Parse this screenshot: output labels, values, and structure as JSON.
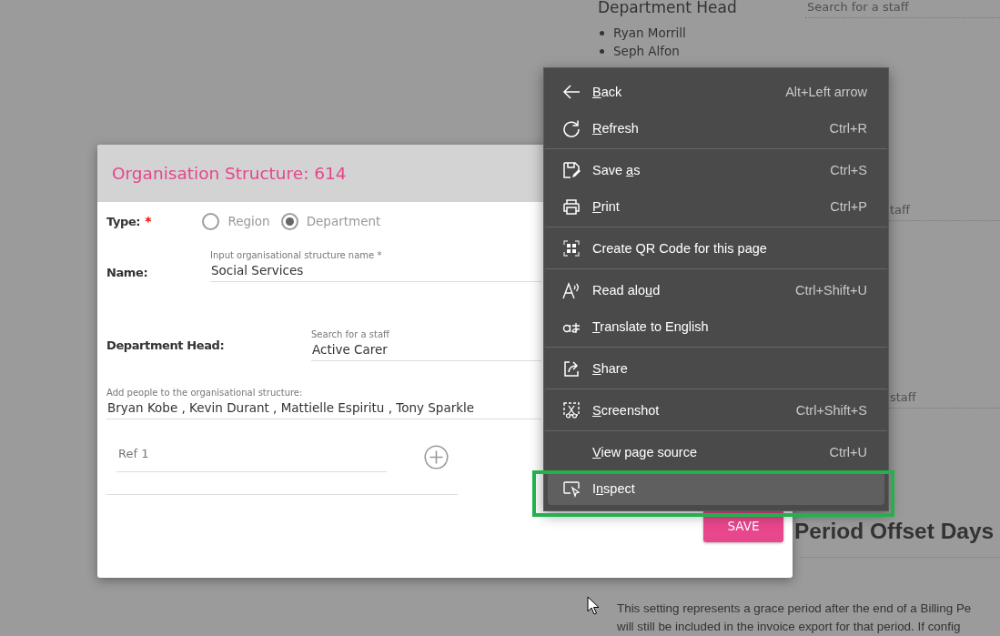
{
  "background_page": {
    "department_head": {
      "heading": "Department Head",
      "people": [
        "Ryan Morrill",
        "Seph Alfon"
      ]
    },
    "staff_search_fields": [
      {
        "placeholder": "Search for a staff"
      },
      {
        "placeholder": "taff"
      },
      {
        "placeholder": "staff"
      }
    ],
    "offset_section": {
      "heading": "Period Offset Days",
      "description_lines": [
        "This setting represents a grace period after the end of a Billing Pe",
        "will still be included in the invoice export for that period. If config"
      ]
    }
  },
  "dialog": {
    "title": "Organisation Structure: 614",
    "type_label": "Type:",
    "required_mark": "*",
    "type_options": [
      {
        "label": "Region",
        "selected": false
      },
      {
        "label": "Department",
        "selected": true
      }
    ],
    "name_label": "Name:",
    "name_field": {
      "label": "Input organisational structure name *",
      "value": "Social Services"
    },
    "head_label": "Department Head:",
    "head_field": {
      "label": "Search for a staff",
      "value": "Active Carer"
    },
    "people_field": {
      "label": "Add people to the organisational structure:",
      "value": "Bryan Kobe , Kevin Durant , Mattielle Espiritu , Tony Sparkle"
    },
    "ref_field": {
      "placeholder": "Ref 1"
    },
    "save_button": "SAVE"
  },
  "context_menu": {
    "groups": [
      {
        "items": [
          {
            "kind": "back",
            "access_key": "B",
            "label_rest": "ack",
            "shortcut": "Alt+Left arrow",
            "selected": false
          },
          {
            "kind": "refresh",
            "access_key": "R",
            "label_rest": "efresh",
            "shortcut": "Ctrl+R",
            "selected": false
          }
        ]
      },
      {
        "items": [
          {
            "kind": "save",
            "label_start": "Save ",
            "access_key": "a",
            "label_rest": "s",
            "shortcut": "Ctrl+S",
            "selected": false
          },
          {
            "kind": "print",
            "access_key": "P",
            "label_rest": "rint",
            "shortcut": "Ctrl+P",
            "selected": false
          }
        ]
      },
      {
        "items": [
          {
            "kind": "qr",
            "label_start": "Create QR Code for this page",
            "selected": false
          }
        ]
      },
      {
        "items": [
          {
            "kind": "read",
            "label_start": "Read alo",
            "access_key": "u",
            "label_rest": "d",
            "shortcut": "Ctrl+Shift+U",
            "selected": false
          },
          {
            "kind": "translate",
            "access_key": "T",
            "label_rest": "ranslate to English",
            "selected": false
          }
        ]
      },
      {
        "items": [
          {
            "kind": "share",
            "access_key": "S",
            "label_rest": "hare",
            "selected": false
          }
        ]
      },
      {
        "items": [
          {
            "kind": "screenshot",
            "access_key": "S",
            "label_rest": "creenshot",
            "shortcut": "Ctrl+Shift+S",
            "selected": false
          }
        ]
      },
      {
        "items": [
          {
            "kind": "plain",
            "access_key": "V",
            "label_rest": "iew page source",
            "shortcut": "Ctrl+U",
            "selected": false
          },
          {
            "kind": "inspect",
            "label_start": "I",
            "access_key": "n",
            "label_rest": "spect",
            "selected": true
          }
        ]
      }
    ]
  }
}
